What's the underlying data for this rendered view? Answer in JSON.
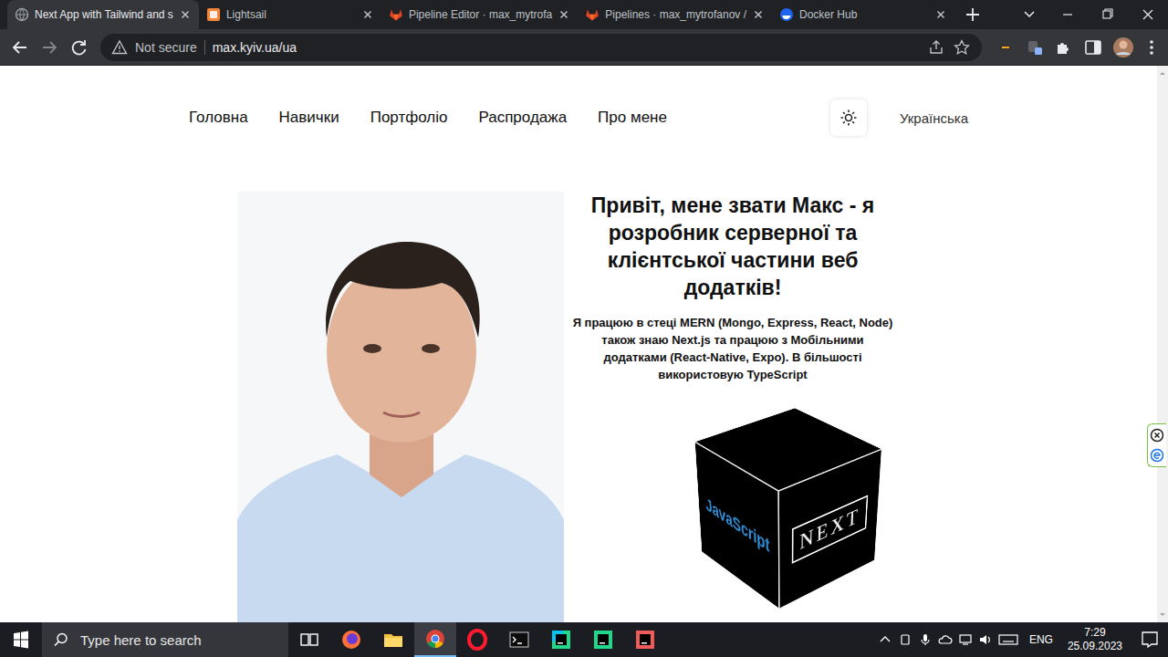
{
  "browser": {
    "tabs": [
      {
        "label": "Next App with Tailwind and s",
        "selected": true,
        "kind": "page"
      },
      {
        "label": "Lightsail",
        "selected": false,
        "kind": "aws"
      },
      {
        "label": "Pipeline Editor · max_mytrofa",
        "selected": false,
        "kind": "gitlab"
      },
      {
        "label": "Pipelines · max_mytrofanov /",
        "selected": false,
        "kind": "gitlab"
      },
      {
        "label": "Docker Hub",
        "selected": false,
        "kind": "docker"
      }
    ],
    "address": {
      "security": "Not secure",
      "url": "max.kyiv.ua/ua"
    }
  },
  "page": {
    "nav": [
      "Головна",
      "Навички",
      "Портфоліо",
      "Распродажа",
      "Про мене"
    ],
    "language": "Українська",
    "hero": {
      "title": "Привіт, мене звати Макс - я розробник серверної та клієнтської частини веб додатків!",
      "text": "Я працюю в стеці MERN (Mongo, Express, React, Node) також знаю Next.js та працюю з Мобільними додатками (React-Native, Expo). В більшості використовую TypeScript",
      "cube_faces": [
        "NEXT",
        "JavaScript"
      ]
    }
  },
  "taskbar": {
    "search_placeholder": "Type here to search",
    "apps": [
      {
        "kind": "task-view",
        "active": false
      },
      {
        "kind": "firefox",
        "active": false
      },
      {
        "kind": "explorer",
        "active": false
      },
      {
        "kind": "chrome",
        "active": true
      },
      {
        "kind": "opera",
        "active": false
      },
      {
        "kind": "terminal",
        "active": false
      },
      {
        "kind": "webstorm",
        "active": false
      },
      {
        "kind": "pycharm",
        "active": false
      },
      {
        "kind": "clion",
        "active": false
      }
    ],
    "language": "ENG",
    "time": "7:29",
    "date": "25.09.2023"
  }
}
